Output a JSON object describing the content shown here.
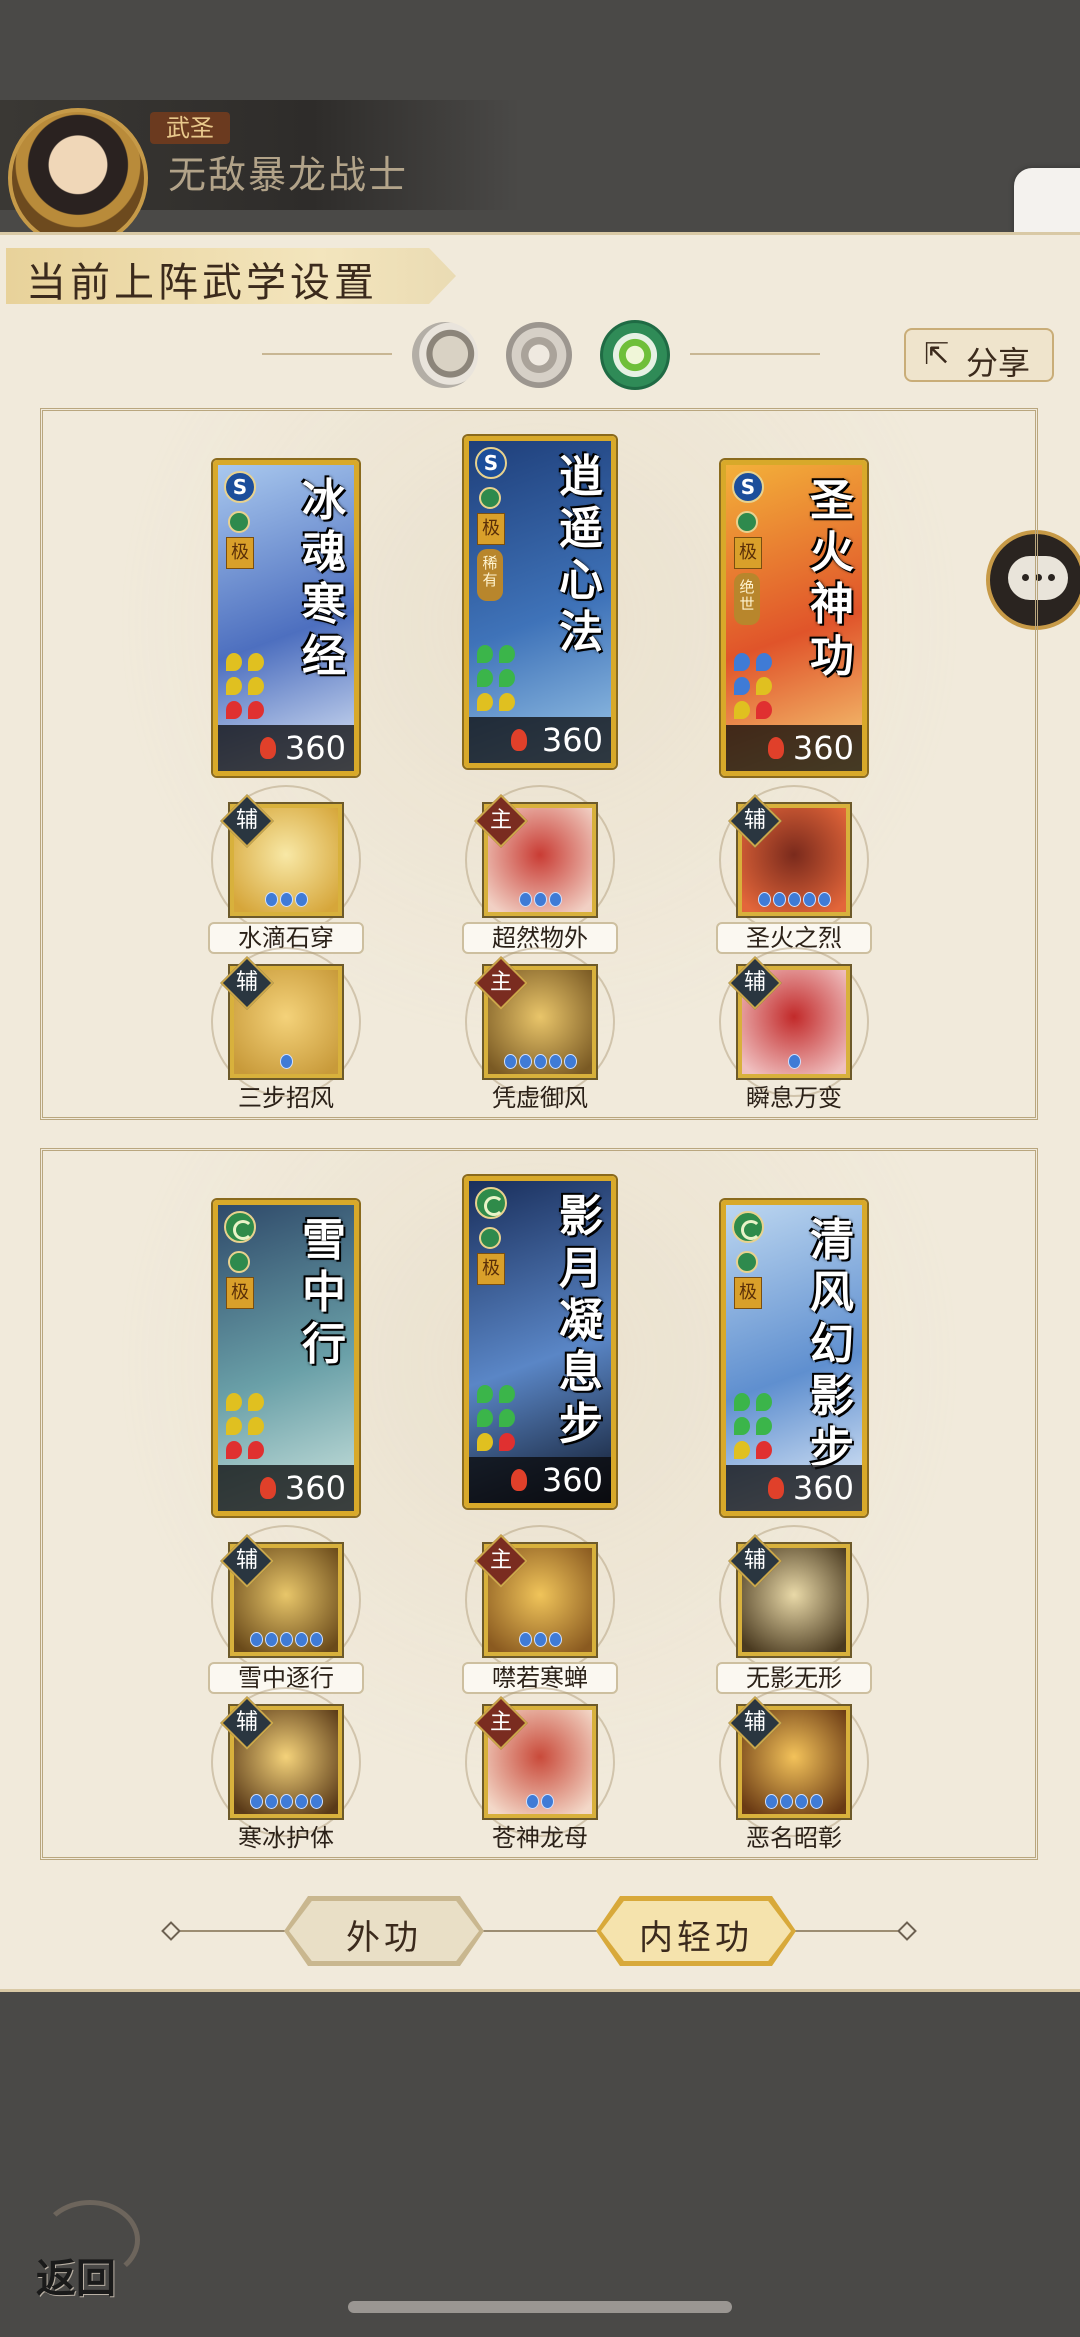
{
  "header": {
    "rank": "武圣",
    "player_name": "无敌暴龙战士"
  },
  "panel": {
    "title": "当前上阵武学设置",
    "share_label": "分享",
    "side_tab_glyph": "❮"
  },
  "element_tabs": [
    {
      "name": "moon",
      "selected": false
    },
    {
      "name": "sun",
      "selected": false
    },
    {
      "name": "nature",
      "selected": true
    }
  ],
  "sections": [
    {
      "cards": [
        {
          "name": "冰魂寒经",
          "element": "S",
          "grade": "极",
          "rarity": "",
          "level": "360",
          "pips": [
            "#e0c020",
            "#e0c020",
            "#e0c020",
            "#e0c020",
            "#e03030",
            "#e03030"
          ],
          "art": [
            "#a9c8ee",
            "#4d6fbf",
            "#dfe9f7"
          ]
        },
        {
          "name": "逍遥心法",
          "element": "S",
          "grade": "极",
          "rarity": "稀有",
          "level": "360",
          "pips": [
            "#3bb54a",
            "#3bb54a",
            "#3bb54a",
            "#3bb54a",
            "#e0c020",
            "#e0c020"
          ],
          "art": [
            "#1f3f7a",
            "#3f73b9",
            "#9cc7e8"
          ]
        },
        {
          "name": "圣火神功",
          "element": "S",
          "grade": "极",
          "rarity": "绝世",
          "level": "360",
          "pips": [
            "#3f7bd6",
            "#3f7bd6",
            "#3f7bd6",
            "#e0c020",
            "#e0c020",
            "#e03030"
          ],
          "art": [
            "#f3b03a",
            "#e0542a",
            "#f7d27a"
          ]
        }
      ],
      "skills": [
        [
          {
            "label": "水滴石穿",
            "tag": "辅",
            "dots": 3,
            "art": [
              "#f8e8a6",
              "#d6a63a"
            ]
          },
          {
            "label": "超然物外",
            "tag": "主",
            "dots": 3,
            "art": [
              "#c93c34",
              "#f1d0c4"
            ]
          },
          {
            "label": "圣火之烈",
            "tag": "辅",
            "dots": 5,
            "art": [
              "#7a2a1c",
              "#e3663a"
            ]
          }
        ],
        [
          {
            "label": "三步招风",
            "tag": "辅",
            "dots": 1,
            "art": [
              "#f4d27a",
              "#c89a3a"
            ]
          },
          {
            "label": "凭虚御风",
            "tag": "主",
            "dots": 5,
            "art": [
              "#e9c56a",
              "#7a5a24"
            ]
          },
          {
            "label": "瞬息万变",
            "tag": "辅",
            "dots": 1,
            "art": [
              "#c22a2a",
              "#f0c0c0"
            ]
          }
        ]
      ]
    },
    {
      "cards": [
        {
          "name": "雪中行",
          "element": "G",
          "grade": "极",
          "rarity": "",
          "level": "360",
          "pips": [
            "#e0c020",
            "#e0c020",
            "#e0c020",
            "#e0c020",
            "#e03030",
            "#e03030"
          ],
          "art": [
            "#2f4a6a",
            "#6aa0a8",
            "#cfe6e0"
          ]
        },
        {
          "name": "影月凝息步",
          "element": "G",
          "grade": "极",
          "rarity": "",
          "level": "360",
          "pips": [
            "#3bb54a",
            "#3bb54a",
            "#3bb54a",
            "#3bb54a",
            "#e0c020",
            "#e03030"
          ],
          "art": [
            "#1a2f5c",
            "#5a86c6",
            "#0e1626"
          ]
        },
        {
          "name": "清风幻影步",
          "element": "G",
          "grade": "极",
          "rarity": "",
          "level": "360",
          "pips": [
            "#3bb54a",
            "#3bb54a",
            "#3bb54a",
            "#3bb54a",
            "#e0c020",
            "#e03030"
          ],
          "art": [
            "#bcd6f0",
            "#5f8fcf",
            "#e8f1fb"
          ]
        }
      ],
      "skills": [
        [
          {
            "label": "雪中逐行",
            "tag": "辅",
            "dots": 5,
            "art": [
              "#e8c66a",
              "#6a4a1a"
            ]
          },
          {
            "label": "噤若寒蝉",
            "tag": "主",
            "dots": 3,
            "art": [
              "#f0c45a",
              "#8a5a20"
            ]
          },
          {
            "label": "无影无形",
            "tag": "辅",
            "dots": 0,
            "art": [
              "#e9d9a8",
              "#4a3a20"
            ]
          }
        ],
        [
          {
            "label": "寒冰护体",
            "tag": "辅",
            "dots": 5,
            "art": [
              "#f4d27a",
              "#5a3a18"
            ]
          },
          {
            "label": "苍神龙母",
            "tag": "主",
            "dots": 2,
            "art": [
              "#c94a3a",
              "#f3d8c8"
            ]
          },
          {
            "label": "恶名昭彰",
            "tag": "辅",
            "dots": 4,
            "art": [
              "#f3c25a",
              "#6a3a14"
            ]
          }
        ]
      ]
    }
  ],
  "bottom_tabs": {
    "outer": "外功",
    "inner": "内轻功",
    "active": "inner"
  },
  "footer": {
    "back_label": "返回"
  }
}
